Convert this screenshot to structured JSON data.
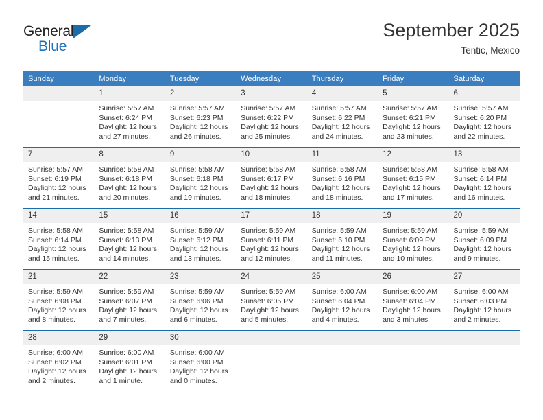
{
  "brand": {
    "name_part1": "General",
    "name_part2": "Blue",
    "accent_color": "#1b6cab"
  },
  "header": {
    "title": "September 2025",
    "subtitle": "Tentic, Mexico"
  },
  "calendar": {
    "header_bg": "#3a7ebf",
    "daynum_bg": "#efefef",
    "weekday_headers": [
      "Sunday",
      "Monday",
      "Tuesday",
      "Wednesday",
      "Thursday",
      "Friday",
      "Saturday"
    ],
    "weeks": [
      [
        {
          "day": "",
          "sunrise": "",
          "sunset": "",
          "daylight": "",
          "empty": true
        },
        {
          "day": "1",
          "sunrise": "Sunrise: 5:57 AM",
          "sunset": "Sunset: 6:24 PM",
          "daylight": "Daylight: 12 hours and 27 minutes."
        },
        {
          "day": "2",
          "sunrise": "Sunrise: 5:57 AM",
          "sunset": "Sunset: 6:23 PM",
          "daylight": "Daylight: 12 hours and 26 minutes."
        },
        {
          "day": "3",
          "sunrise": "Sunrise: 5:57 AM",
          "sunset": "Sunset: 6:22 PM",
          "daylight": "Daylight: 12 hours and 25 minutes."
        },
        {
          "day": "4",
          "sunrise": "Sunrise: 5:57 AM",
          "sunset": "Sunset: 6:22 PM",
          "daylight": "Daylight: 12 hours and 24 minutes."
        },
        {
          "day": "5",
          "sunrise": "Sunrise: 5:57 AM",
          "sunset": "Sunset: 6:21 PM",
          "daylight": "Daylight: 12 hours and 23 minutes."
        },
        {
          "day": "6",
          "sunrise": "Sunrise: 5:57 AM",
          "sunset": "Sunset: 6:20 PM",
          "daylight": "Daylight: 12 hours and 22 minutes."
        }
      ],
      [
        {
          "day": "7",
          "sunrise": "Sunrise: 5:57 AM",
          "sunset": "Sunset: 6:19 PM",
          "daylight": "Daylight: 12 hours and 21 minutes."
        },
        {
          "day": "8",
          "sunrise": "Sunrise: 5:58 AM",
          "sunset": "Sunset: 6:18 PM",
          "daylight": "Daylight: 12 hours and 20 minutes."
        },
        {
          "day": "9",
          "sunrise": "Sunrise: 5:58 AM",
          "sunset": "Sunset: 6:18 PM",
          "daylight": "Daylight: 12 hours and 19 minutes."
        },
        {
          "day": "10",
          "sunrise": "Sunrise: 5:58 AM",
          "sunset": "Sunset: 6:17 PM",
          "daylight": "Daylight: 12 hours and 18 minutes."
        },
        {
          "day": "11",
          "sunrise": "Sunrise: 5:58 AM",
          "sunset": "Sunset: 6:16 PM",
          "daylight": "Daylight: 12 hours and 18 minutes."
        },
        {
          "day": "12",
          "sunrise": "Sunrise: 5:58 AM",
          "sunset": "Sunset: 6:15 PM",
          "daylight": "Daylight: 12 hours and 17 minutes."
        },
        {
          "day": "13",
          "sunrise": "Sunrise: 5:58 AM",
          "sunset": "Sunset: 6:14 PM",
          "daylight": "Daylight: 12 hours and 16 minutes."
        }
      ],
      [
        {
          "day": "14",
          "sunrise": "Sunrise: 5:58 AM",
          "sunset": "Sunset: 6:14 PM",
          "daylight": "Daylight: 12 hours and 15 minutes."
        },
        {
          "day": "15",
          "sunrise": "Sunrise: 5:58 AM",
          "sunset": "Sunset: 6:13 PM",
          "daylight": "Daylight: 12 hours and 14 minutes."
        },
        {
          "day": "16",
          "sunrise": "Sunrise: 5:59 AM",
          "sunset": "Sunset: 6:12 PM",
          "daylight": "Daylight: 12 hours and 13 minutes."
        },
        {
          "day": "17",
          "sunrise": "Sunrise: 5:59 AM",
          "sunset": "Sunset: 6:11 PM",
          "daylight": "Daylight: 12 hours and 12 minutes."
        },
        {
          "day": "18",
          "sunrise": "Sunrise: 5:59 AM",
          "sunset": "Sunset: 6:10 PM",
          "daylight": "Daylight: 12 hours and 11 minutes."
        },
        {
          "day": "19",
          "sunrise": "Sunrise: 5:59 AM",
          "sunset": "Sunset: 6:09 PM",
          "daylight": "Daylight: 12 hours and 10 minutes."
        },
        {
          "day": "20",
          "sunrise": "Sunrise: 5:59 AM",
          "sunset": "Sunset: 6:09 PM",
          "daylight": "Daylight: 12 hours and 9 minutes."
        }
      ],
      [
        {
          "day": "21",
          "sunrise": "Sunrise: 5:59 AM",
          "sunset": "Sunset: 6:08 PM",
          "daylight": "Daylight: 12 hours and 8 minutes."
        },
        {
          "day": "22",
          "sunrise": "Sunrise: 5:59 AM",
          "sunset": "Sunset: 6:07 PM",
          "daylight": "Daylight: 12 hours and 7 minutes."
        },
        {
          "day": "23",
          "sunrise": "Sunrise: 5:59 AM",
          "sunset": "Sunset: 6:06 PM",
          "daylight": "Daylight: 12 hours and 6 minutes."
        },
        {
          "day": "24",
          "sunrise": "Sunrise: 5:59 AM",
          "sunset": "Sunset: 6:05 PM",
          "daylight": "Daylight: 12 hours and 5 minutes."
        },
        {
          "day": "25",
          "sunrise": "Sunrise: 6:00 AM",
          "sunset": "Sunset: 6:04 PM",
          "daylight": "Daylight: 12 hours and 4 minutes."
        },
        {
          "day": "26",
          "sunrise": "Sunrise: 6:00 AM",
          "sunset": "Sunset: 6:04 PM",
          "daylight": "Daylight: 12 hours and 3 minutes."
        },
        {
          "day": "27",
          "sunrise": "Sunrise: 6:00 AM",
          "sunset": "Sunset: 6:03 PM",
          "daylight": "Daylight: 12 hours and 2 minutes."
        }
      ],
      [
        {
          "day": "28",
          "sunrise": "Sunrise: 6:00 AM",
          "sunset": "Sunset: 6:02 PM",
          "daylight": "Daylight: 12 hours and 2 minutes."
        },
        {
          "day": "29",
          "sunrise": "Sunrise: 6:00 AM",
          "sunset": "Sunset: 6:01 PM",
          "daylight": "Daylight: 12 hours and 1 minute."
        },
        {
          "day": "30",
          "sunrise": "Sunrise: 6:00 AM",
          "sunset": "Sunset: 6:00 PM",
          "daylight": "Daylight: 12 hours and 0 minutes."
        },
        {
          "day": "",
          "sunrise": "",
          "sunset": "",
          "daylight": "",
          "empty": true
        },
        {
          "day": "",
          "sunrise": "",
          "sunset": "",
          "daylight": "",
          "empty": true
        },
        {
          "day": "",
          "sunrise": "",
          "sunset": "",
          "daylight": "",
          "empty": true
        },
        {
          "day": "",
          "sunrise": "",
          "sunset": "",
          "daylight": "",
          "empty": true
        }
      ]
    ]
  }
}
